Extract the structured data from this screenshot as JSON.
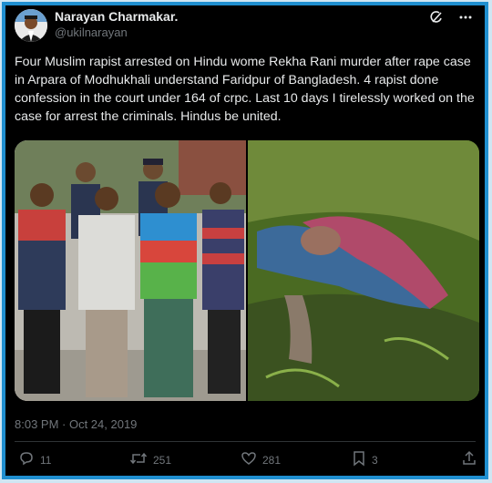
{
  "author": {
    "name": "Narayan Charmakar.",
    "handle": "@ukilnarayan"
  },
  "icons": {
    "header": [
      "grok-icon",
      "more-icon"
    ],
    "actions": [
      "reply-icon",
      "retweet-icon",
      "like-icon",
      "bookmark-icon",
      "share-icon"
    ]
  },
  "tweet": {
    "text": "Four Muslim rapist arrested on Hindu wome Rekha Rani murder after rape case in Arpara of Modhukhali understand Faridpur of Bangladesh. 4 rapist done confession in the court under 164 of crpc. Last 10 days I tirelessly worked on the case for arrest the criminals. Hindus be united.",
    "timestamp": "8:03 PM · Oct 24, 2019"
  },
  "stats": {
    "replies": "11",
    "retweets": "251",
    "likes": "281",
    "bookmarks": "3"
  },
  "colors": {
    "background": "#000000",
    "text": "#e7e9ea",
    "muted": "#71767b",
    "frame": "#1f8fd0"
  }
}
